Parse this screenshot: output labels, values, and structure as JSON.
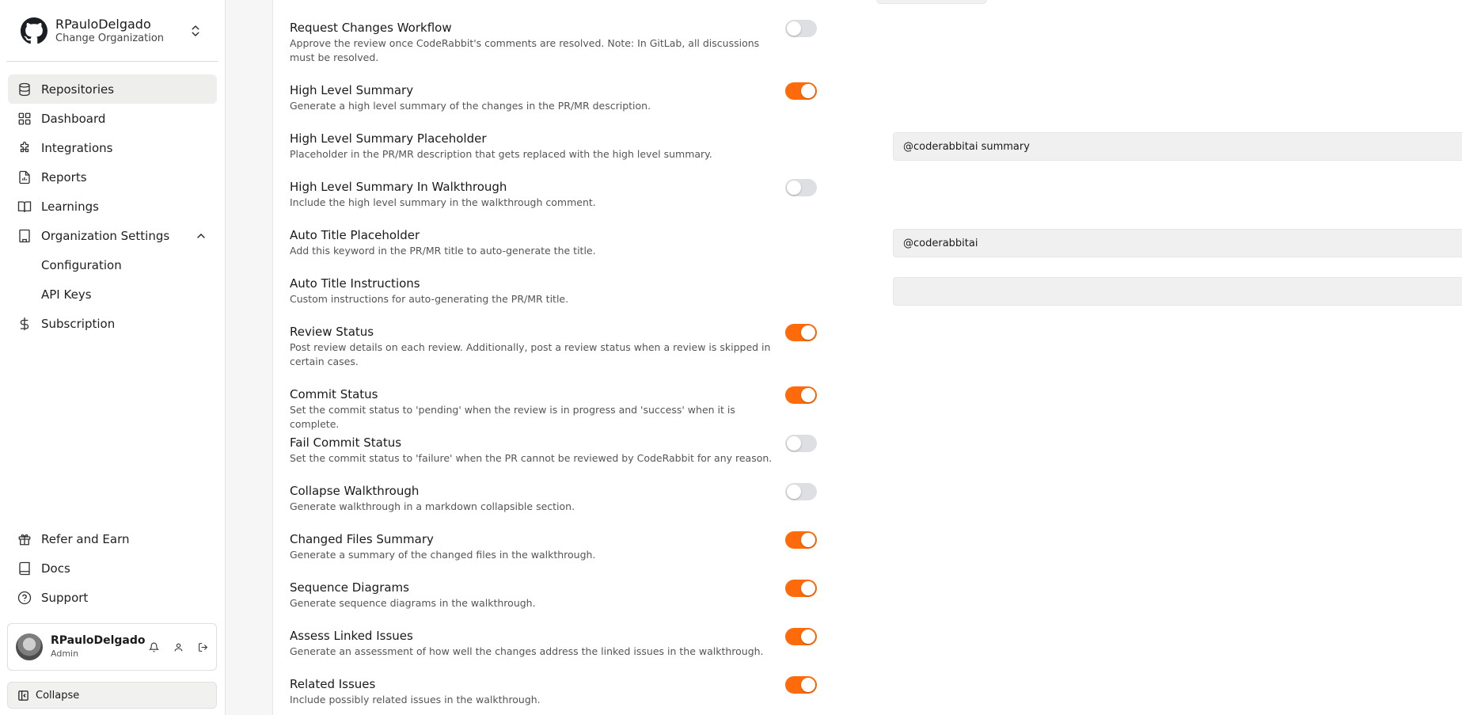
{
  "org": {
    "name": "RPauloDelgado",
    "subtitle": "Change Organization"
  },
  "nav": {
    "items": [
      {
        "label": "Repositories",
        "icon": "database-icon",
        "active": true
      },
      {
        "label": "Dashboard",
        "icon": "grid-icon"
      },
      {
        "label": "Integrations",
        "icon": "puzzle-icon"
      },
      {
        "label": "Reports",
        "icon": "report-icon"
      },
      {
        "label": "Learnings",
        "icon": "book-open-icon"
      },
      {
        "label": "Organization Settings",
        "icon": "building-icon",
        "expanded": true
      }
    ],
    "sub_items": [
      {
        "label": "Configuration"
      },
      {
        "label": "API Keys"
      }
    ],
    "subscription": {
      "label": "Subscription",
      "icon": "dollar-icon"
    }
  },
  "bottom_nav": [
    {
      "label": "Refer and Earn",
      "icon": "gift-icon"
    },
    {
      "label": "Docs",
      "icon": "book-icon"
    },
    {
      "label": "Support",
      "icon": "help-circle-icon"
    }
  ],
  "user": {
    "name": "RPauloDelgado",
    "role": "Admin"
  },
  "collapse_label": "Collapse",
  "colors": {
    "accent": "#ff6b0a",
    "toggle_off": "#dedfe2",
    "active_nav_bg": "#eeeeec"
  },
  "settings": [
    {
      "title": "Request Changes Workflow",
      "desc": "Approve the review once CodeRabbit's comments are resolved. Note: In GitLab, all discussions must be resolved.",
      "control": "toggle",
      "on": false
    },
    {
      "title": "High Level Summary",
      "desc": "Generate a high level summary of the changes in the PR/MR description.",
      "control": "toggle",
      "on": true
    },
    {
      "title": "High Level Summary Placeholder",
      "desc": "Placeholder in the PR/MR description that gets replaced with the high level summary.",
      "control": "input",
      "value": "@coderabbitai summary"
    },
    {
      "title": "High Level Summary In Walkthrough",
      "desc": "Include the high level summary in the walkthrough comment.",
      "control": "toggle",
      "on": false
    },
    {
      "title": "Auto Title Placeholder",
      "desc": "Add this keyword in the PR/MR title to auto-generate the title.",
      "control": "input",
      "value": "@coderabbitai"
    },
    {
      "title": "Auto Title Instructions",
      "desc": "Custom instructions for auto-generating the PR/MR title.",
      "control": "input",
      "value": ""
    },
    {
      "title": "Review Status",
      "desc": "Post review details on each review. Additionally, post a review status when a review is skipped in certain cases.",
      "control": "toggle",
      "on": true
    },
    {
      "title": "Commit Status",
      "desc": "Set the commit status to 'pending' when the review is in progress and 'success' when it is complete.",
      "control": "toggle",
      "on": true
    },
    {
      "title": "Fail Commit Status",
      "desc": "Set the commit status to 'failure' when the PR cannot be reviewed by CodeRabbit for any reason.",
      "control": "toggle",
      "on": false
    },
    {
      "title": "Collapse Walkthrough",
      "desc": "Generate walkthrough in a markdown collapsible section.",
      "control": "toggle",
      "on": false
    },
    {
      "title": "Changed Files Summary",
      "desc": "Generate a summary of the changed files in the walkthrough.",
      "control": "toggle",
      "on": true
    },
    {
      "title": "Sequence Diagrams",
      "desc": "Generate sequence diagrams in the walkthrough.",
      "control": "toggle",
      "on": true
    },
    {
      "title": "Assess Linked Issues",
      "desc": "Generate an assessment of how well the changes address the linked issues in the walkthrough.",
      "control": "toggle",
      "on": true
    },
    {
      "title": "Related Issues",
      "desc": "Include possibly related issues in the walkthrough.",
      "control": "toggle",
      "on": true
    }
  ]
}
